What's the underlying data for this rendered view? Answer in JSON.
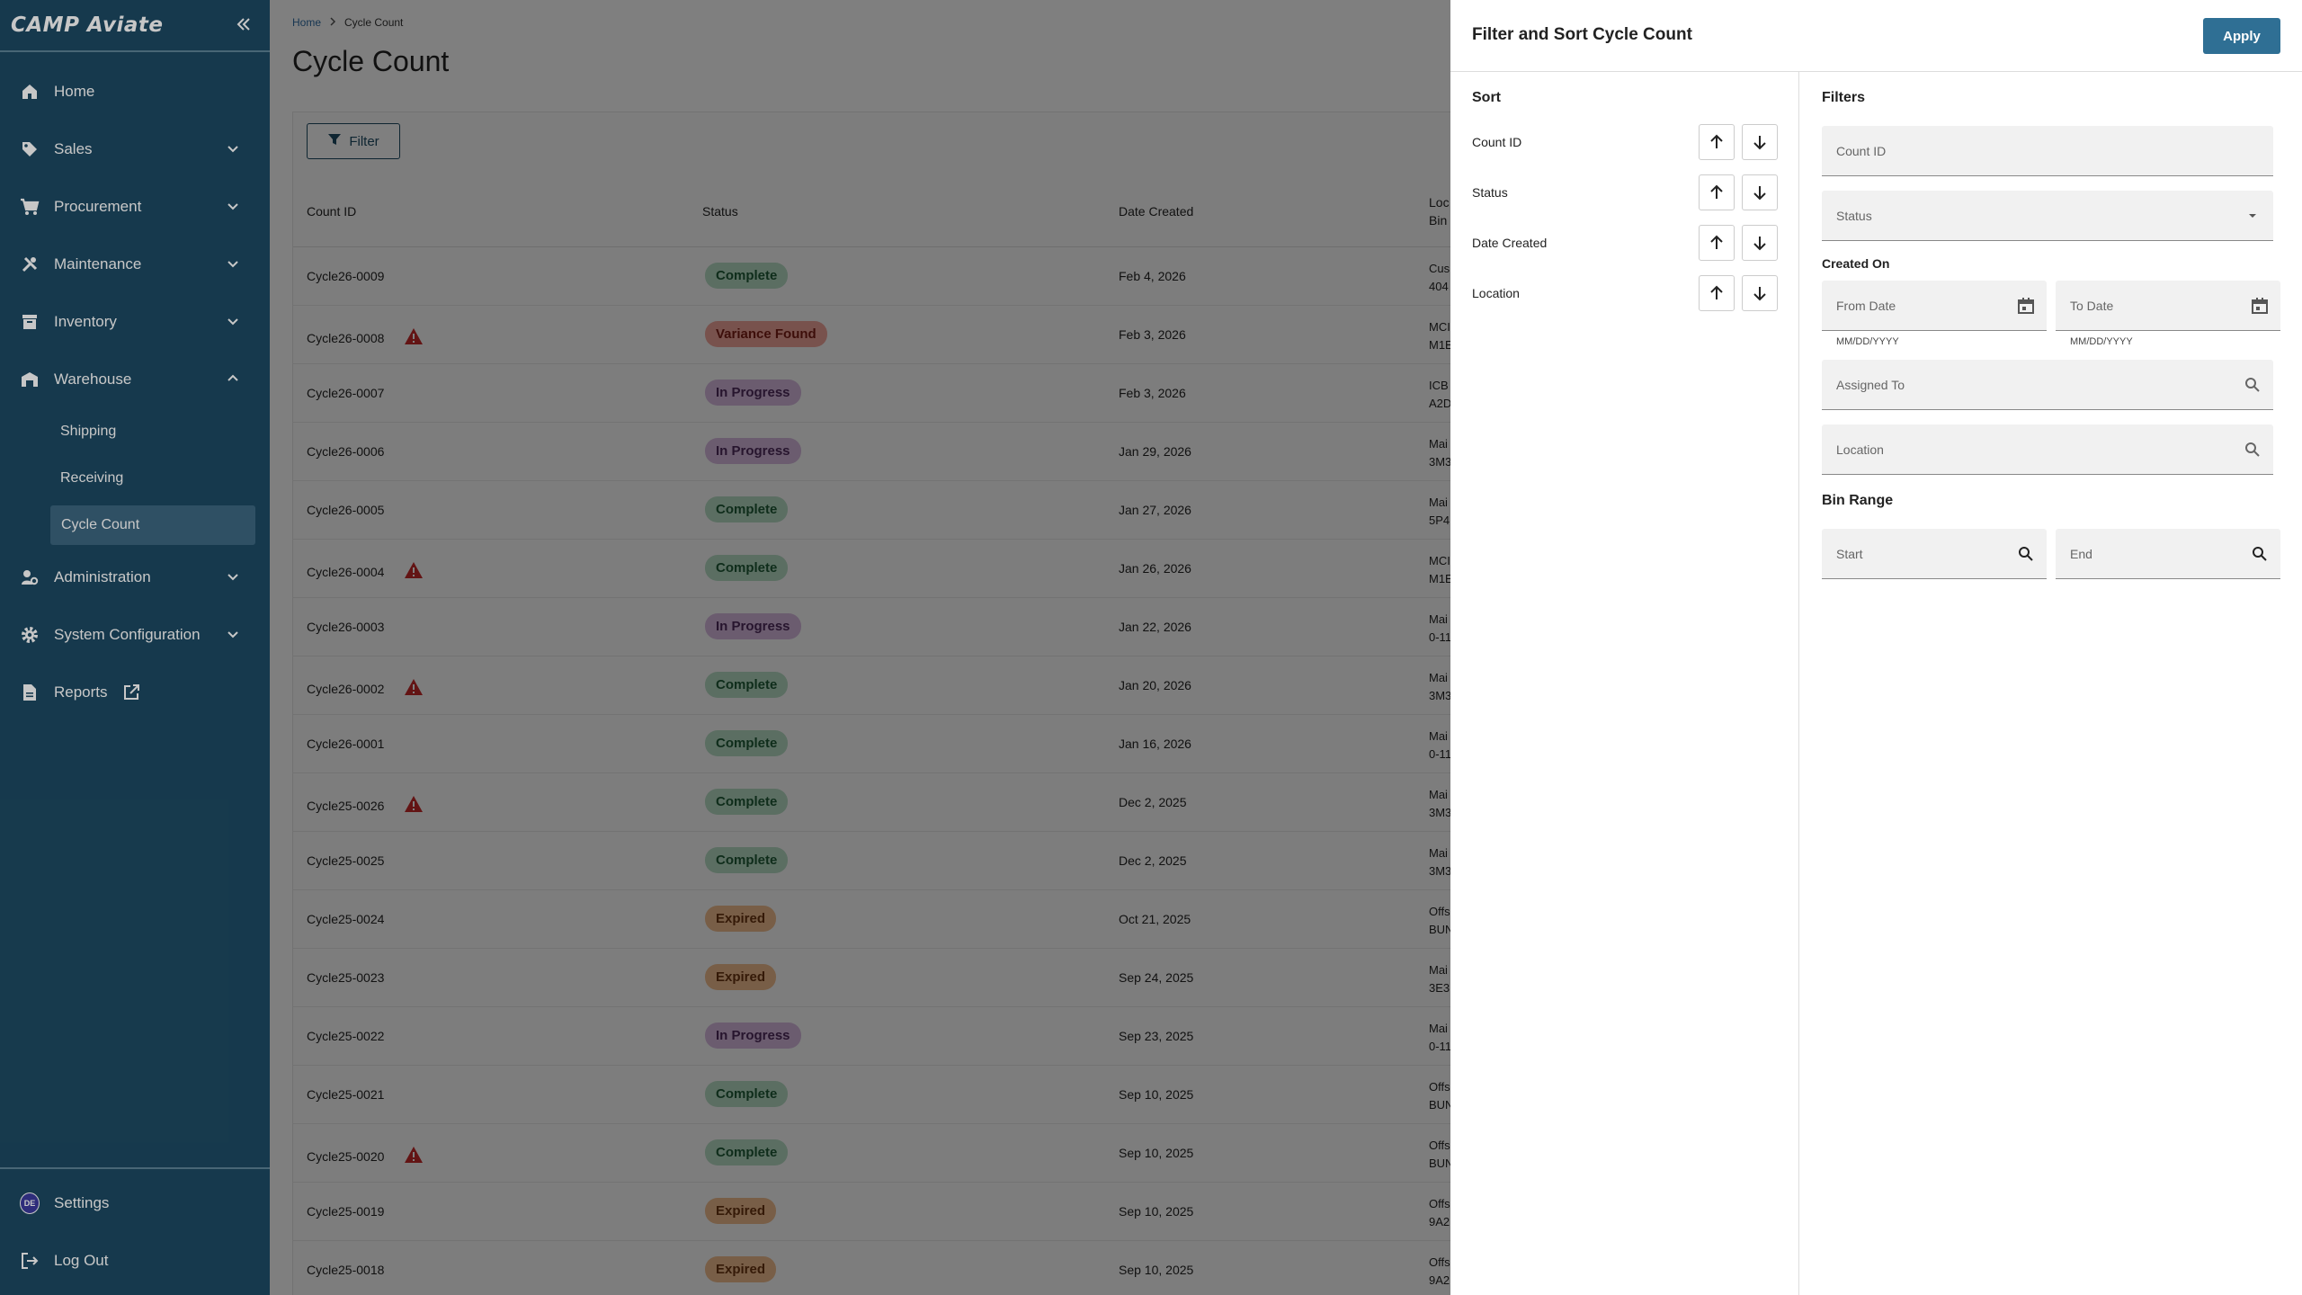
{
  "app": {
    "logo": "CAMP Aviate"
  },
  "sidebar": {
    "items": [
      {
        "label": "Home",
        "icon": "home-icon"
      },
      {
        "label": "Sales",
        "icon": "tag-icon"
      },
      {
        "label": "Procurement",
        "icon": "cart-icon"
      },
      {
        "label": "Maintenance",
        "icon": "tools-icon"
      },
      {
        "label": "Inventory",
        "icon": "archive-icon"
      },
      {
        "label": "Warehouse",
        "icon": "warehouse-icon"
      },
      {
        "label": "Administration",
        "icon": "admin-icon"
      },
      {
        "label": "System Configuration",
        "icon": "gear-icon"
      },
      {
        "label": "Reports",
        "icon": "document-icon"
      }
    ],
    "warehouse_sub": [
      "Shipping",
      "Receiving",
      "Cycle Count"
    ],
    "bottom": {
      "settings": "Settings",
      "avatar_initials": "DE",
      "logout": "Log Out"
    }
  },
  "breadcrumb": {
    "home": "Home",
    "current": "Cycle Count"
  },
  "page": {
    "title": "Cycle Count",
    "filter_button": "Filter"
  },
  "table": {
    "headers": {
      "count_id": "Count ID",
      "status": "Status",
      "date_created": "Date Created",
      "location_line1": "Loc",
      "location_line2": "Bin"
    },
    "rows": [
      {
        "id": "Cycle26-0009",
        "warn": false,
        "status": "Complete",
        "date": "Feb 4, 2026",
        "loc1": "Cus",
        "loc2": "404"
      },
      {
        "id": "Cycle26-0008",
        "warn": true,
        "status": "Variance Found",
        "date": "Feb 3, 2026",
        "loc1": "MCI",
        "loc2": "M1E"
      },
      {
        "id": "Cycle26-0007",
        "warn": false,
        "status": "In Progress",
        "date": "Feb 3, 2026",
        "loc1": "ICB",
        "loc2": "A2D"
      },
      {
        "id": "Cycle26-0006",
        "warn": false,
        "status": "In Progress",
        "date": "Jan 29, 2026",
        "loc1": "Mai",
        "loc2": "3M3"
      },
      {
        "id": "Cycle26-0005",
        "warn": false,
        "status": "Complete",
        "date": "Jan 27, 2026",
        "loc1": "Mai",
        "loc2": "5P4"
      },
      {
        "id": "Cycle26-0004",
        "warn": true,
        "status": "Complete",
        "date": "Jan 26, 2026",
        "loc1": "MCI",
        "loc2": "M1E"
      },
      {
        "id": "Cycle26-0003",
        "warn": false,
        "status": "In Progress",
        "date": "Jan 22, 2026",
        "loc1": "Mai",
        "loc2": "0-11"
      },
      {
        "id": "Cycle26-0002",
        "warn": true,
        "status": "Complete",
        "date": "Jan 20, 2026",
        "loc1": "Mai",
        "loc2": "3M3"
      },
      {
        "id": "Cycle26-0001",
        "warn": false,
        "status": "Complete",
        "date": "Jan 16, 2026",
        "loc1": "Mai",
        "loc2": "0-11"
      },
      {
        "id": "Cycle25-0026",
        "warn": true,
        "status": "Complete",
        "date": "Dec 2, 2025",
        "loc1": "Mai",
        "loc2": "3M3"
      },
      {
        "id": "Cycle25-0025",
        "warn": false,
        "status": "Complete",
        "date": "Dec 2, 2025",
        "loc1": "Mai",
        "loc2": "3M3"
      },
      {
        "id": "Cycle25-0024",
        "warn": false,
        "status": "Expired",
        "date": "Oct 21, 2025",
        "loc1": "Offs",
        "loc2": "BUN"
      },
      {
        "id": "Cycle25-0023",
        "warn": false,
        "status": "Expired",
        "date": "Sep 24, 2025",
        "loc1": "Mai",
        "loc2": "3E3"
      },
      {
        "id": "Cycle25-0022",
        "warn": false,
        "status": "In Progress",
        "date": "Sep 23, 2025",
        "loc1": "Mai",
        "loc2": "0-11"
      },
      {
        "id": "Cycle25-0021",
        "warn": false,
        "status": "Complete",
        "date": "Sep 10, 2025",
        "loc1": "Offs",
        "loc2": "BUN"
      },
      {
        "id": "Cycle25-0020",
        "warn": true,
        "status": "Complete",
        "date": "Sep 10, 2025",
        "loc1": "Offs",
        "loc2": "BUN"
      },
      {
        "id": "Cycle25-0019",
        "warn": false,
        "status": "Expired",
        "date": "Sep 10, 2025",
        "loc1": "Offs",
        "loc2": "9A2"
      },
      {
        "id": "Cycle25-0018",
        "warn": false,
        "status": "Expired",
        "date": "Sep 10, 2025",
        "loc1": "Offs",
        "loc2": "9A2"
      }
    ]
  },
  "status_colors": {
    "Complete": {
      "bg": "#b6dcc4",
      "fg": "#1f5a37"
    },
    "Variance Found": {
      "bg": "#f1a49b",
      "fg": "#7a1d14"
    },
    "In Progress": {
      "bg": "#d7b9df",
      "fg": "#4e2a5c"
    },
    "Expired": {
      "bg": "#f0bd8e",
      "fg": "#6a3410"
    }
  },
  "drawer": {
    "title": "Filter and Sort Cycle Count",
    "apply": "Apply",
    "sort": {
      "heading": "Sort",
      "fields": [
        "Count ID",
        "Status",
        "Date Created",
        "Location"
      ]
    },
    "filters": {
      "heading": "Filters",
      "count_id_placeholder": "Count ID",
      "status_placeholder": "Status",
      "created_on_label": "Created On",
      "from_date_placeholder": "From Date",
      "to_date_placeholder": "To Date",
      "date_hint": "MM/DD/YYYY",
      "assigned_to_placeholder": "Assigned To",
      "location_placeholder": "Location",
      "bin_range_label": "Bin Range",
      "start_placeholder": "Start",
      "end_placeholder": "End"
    }
  },
  "colors": {
    "sidebar_bg": "#1d4a63",
    "accent": "#2f6f94",
    "warning": "#c62828"
  }
}
